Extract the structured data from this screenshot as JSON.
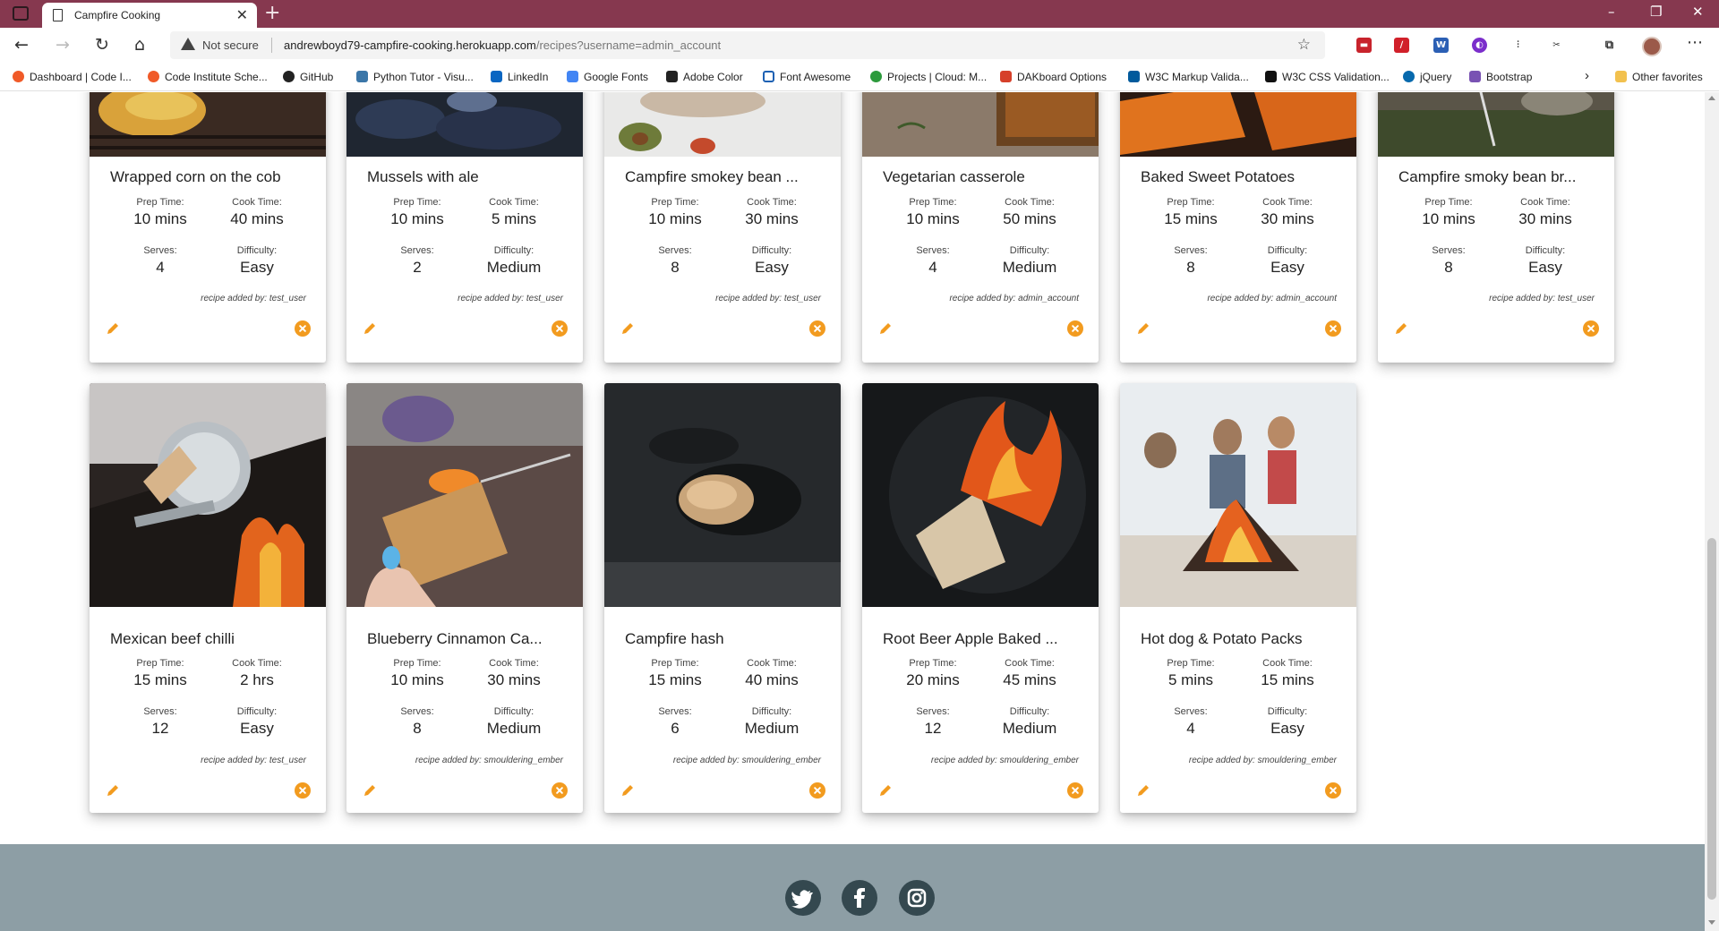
{
  "browser": {
    "tab_title": "Campfire Cooking",
    "security_label": "Not secure",
    "url_host": "andrewboyd79-campfire-cooking.herokuapp.com",
    "url_path": "/recipes?username=admin_account",
    "bookmarks": [
      "Dashboard | Code I...",
      "Code Institute Sche...",
      "GitHub",
      "Python Tutor - Visu...",
      "LinkedIn",
      "Google Fonts",
      "Adobe Color",
      "Font Awesome",
      "Projects | Cloud: M...",
      "DAKboard Options",
      "W3C Markup Valida...",
      "W3C CSS Validation...",
      "jQuery",
      "Bootstrap"
    ],
    "other_favorites": "Other favorites",
    "accent_color": "#86384f"
  },
  "labels": {
    "prep": "Prep Time:",
    "cook": "Cook Time:",
    "serves": "Serves:",
    "difficulty": "Difficulty:"
  },
  "recipes": [
    {
      "title": "Wrapped corn on the cob",
      "prep": "10 mins",
      "cook": "40 mins",
      "serves": "4",
      "difficulty": "Easy",
      "added_by": "recipe added by: test_user"
    },
    {
      "title": "Mussels with ale",
      "prep": "10 mins",
      "cook": "5 mins",
      "serves": "2",
      "difficulty": "Medium",
      "added_by": "recipe added by: test_user"
    },
    {
      "title": "Campfire smokey bean ...",
      "prep": "10 mins",
      "cook": "30 mins",
      "serves": "8",
      "difficulty": "Easy",
      "added_by": "recipe added by: test_user"
    },
    {
      "title": "Vegetarian casserole",
      "prep": "10 mins",
      "cook": "50 mins",
      "serves": "4",
      "difficulty": "Medium",
      "added_by": "recipe added by: admin_account"
    },
    {
      "title": "Baked Sweet Potatoes",
      "prep": "15 mins",
      "cook": "30 mins",
      "serves": "8",
      "difficulty": "Easy",
      "added_by": "recipe added by: admin_account"
    },
    {
      "title": "Campfire smoky bean br...",
      "prep": "10 mins",
      "cook": "30 mins",
      "serves": "8",
      "difficulty": "Easy",
      "added_by": "recipe added by: test_user"
    },
    {
      "title": "Mexican beef chilli",
      "prep": "15 mins",
      "cook": "2 hrs",
      "serves": "12",
      "difficulty": "Easy",
      "added_by": "recipe added by: test_user"
    },
    {
      "title": "Blueberry Cinnamon Ca...",
      "prep": "10 mins",
      "cook": "30 mins",
      "serves": "8",
      "difficulty": "Medium",
      "added_by": "recipe added by: smouldering_ember"
    },
    {
      "title": "Campfire hash",
      "prep": "15 mins",
      "cook": "40 mins",
      "serves": "6",
      "difficulty": "Medium",
      "added_by": "recipe added by: smouldering_ember"
    },
    {
      "title": "Root Beer Apple Baked ...",
      "prep": "20 mins",
      "cook": "45 mins",
      "serves": "12",
      "difficulty": "Medium",
      "added_by": "recipe added by: smouldering_ember"
    },
    {
      "title": "Hot dog & Potato Packs",
      "prep": "5 mins",
      "cook": "15 mins",
      "serves": "4",
      "difficulty": "Easy",
      "added_by": "recipe added by: smouldering_ember"
    }
  ],
  "footer": {
    "social_icons": [
      "twitter-icon",
      "facebook-icon",
      "instagram-icon"
    ],
    "background": "#8d9ea5"
  }
}
